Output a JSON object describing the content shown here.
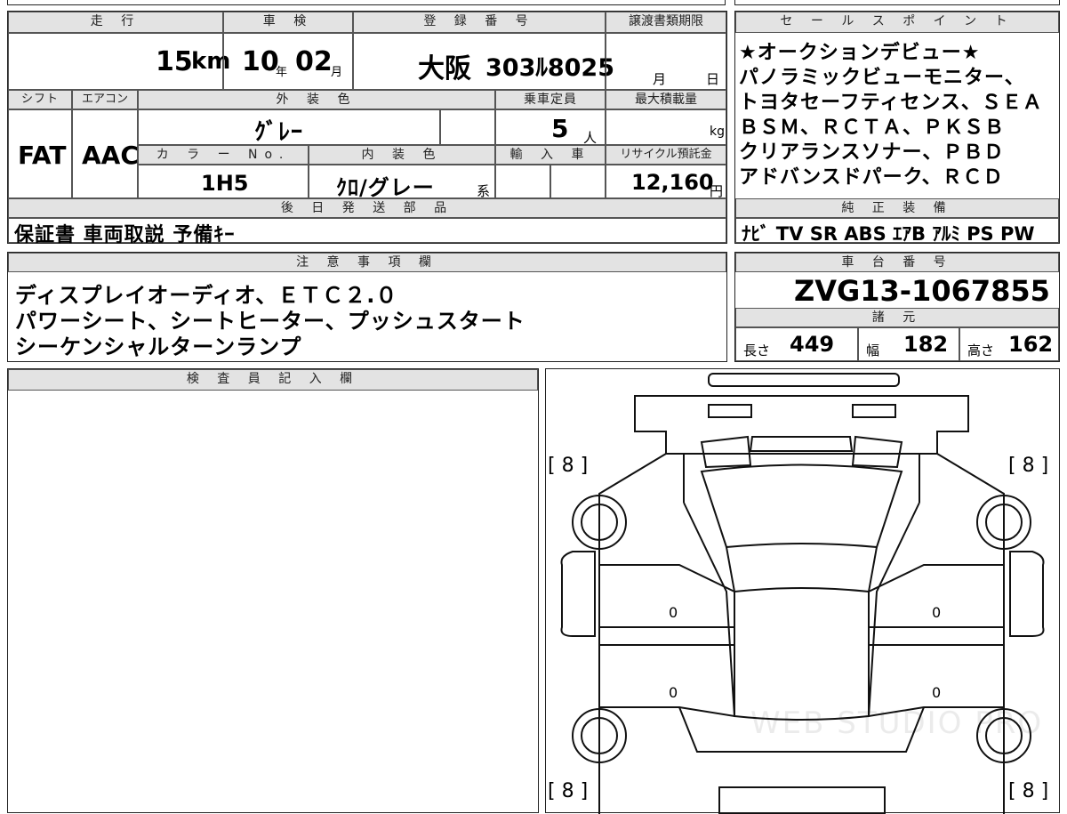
{
  "headers": {
    "mileage": "走 行",
    "inspection": "車 検",
    "registration": "登 録 番 号",
    "transfer_deadline": "譲渡書類期限",
    "selling_points": "セ ー ル ス ポ イ ン ト",
    "shift": "シフト",
    "aircon": "エアコン",
    "exterior_color": "外 装 色",
    "capacity": "乗車定員",
    "max_load": "最大積載量",
    "color_no": "カ ラ ー No.",
    "interior_color": "内 装 色",
    "import": "輸 入 車",
    "recycle_fee": "リサイクル預託金",
    "later_shipment": "後 日 発 送 部 品",
    "genuine_equipment": "純 正 装 備",
    "notes": "注 意 事 項 欄",
    "chassis_number": "車 台 番 号",
    "specs": "諸 元",
    "inspector_notes": "検 査 員 記 入 欄"
  },
  "values": {
    "mileage": "15",
    "mileage_unit": "km",
    "inspection_year": "10",
    "inspection_year_unit": "年",
    "inspection_month": "02",
    "inspection_month_unit": "月",
    "registration_region": "大阪",
    "registration_number": "303ﾙ8025",
    "transfer_month_unit": "月",
    "transfer_day_unit": "日",
    "shift": "FAT",
    "aircon": "AAC",
    "exterior_color": "ｸﾞﾚｰ",
    "capacity": "5",
    "capacity_unit": "人",
    "max_load_unit": "kg",
    "color_no": "1H5",
    "interior_color": "ｸﾛ/グレー",
    "interior_suffix": "系",
    "recycle_fee": "12,160",
    "recycle_fee_unit": "円",
    "later_shipment": "保証書 車両取説 予備ｷｰ",
    "genuine_equipment": "ﾅﾋﾞ TV SR ABS ｴｱB ｱﾙﾐ PS PW",
    "chassis_number": "ZVG13-1067855",
    "length_label": "長さ",
    "length": "449",
    "width_label": "幅",
    "width": "182",
    "height_label": "高さ",
    "height": "162"
  },
  "selling_points": [
    "★オークションデビュー★",
    "パノラミックビューモニター、",
    "トヨタセーフティセンス、ＳＥＡ",
    "ＢＳＭ、ＲＣＴＡ、ＰＫＳＢ",
    "クリアランスソナー、ＰＢＤ",
    "アドバンスドパーク、ＲＣＤ"
  ],
  "notes_lines": [
    "ディスプレイオーディオ、ＥＴＣ２.０",
    "パワーシート、シートヒーター、プッシュスタート",
    "シーケンシャルターンランプ"
  ],
  "diagram": {
    "tire_fl": "[ 8 ]",
    "tire_fr": "[ 8 ]",
    "tire_rl": "[ 8 ]",
    "tire_rr": "[ 8 ]",
    "door_fl": "0",
    "door_rl": "0",
    "door_fr": "0",
    "door_rr": "0",
    "watermark": "WEB STUDIO PRO"
  }
}
